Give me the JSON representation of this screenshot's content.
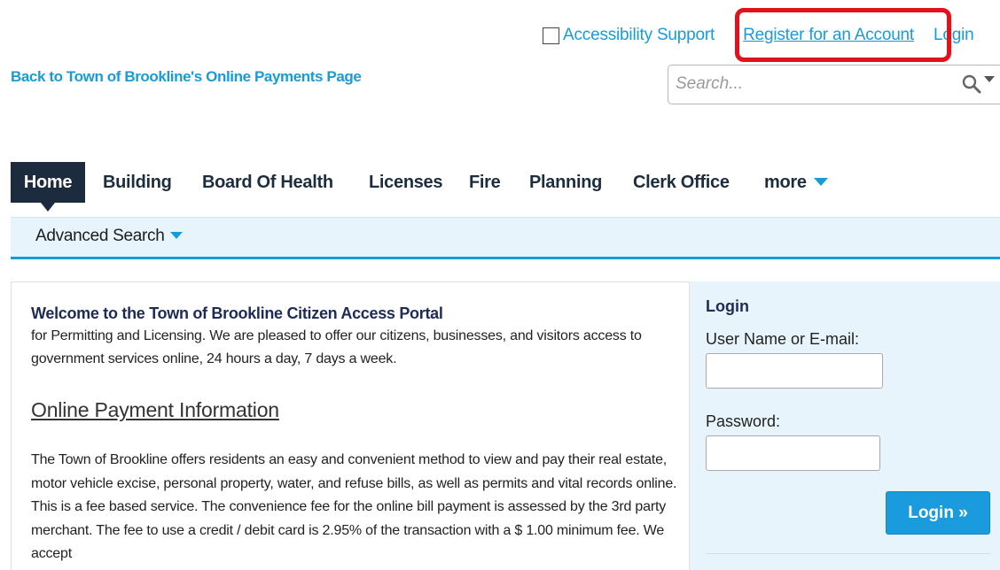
{
  "header": {
    "accessibility_label": "Accessibility Support",
    "register_label": "Register for an Account",
    "login_label": "Login",
    "back_link": "Back to Town of Brookline's Online Payments Page",
    "search_placeholder": "Search..."
  },
  "nav": {
    "tabs": [
      {
        "label": "Home"
      },
      {
        "label": "Building"
      },
      {
        "label": "Board Of Health"
      },
      {
        "label": "Licenses"
      },
      {
        "label": "Fire"
      },
      {
        "label": "Planning"
      },
      {
        "label": "Clerk Office"
      },
      {
        "label": "more"
      }
    ],
    "sub_label": "Advanced Search"
  },
  "main": {
    "welcome_title": "Welcome to the Town of Brookline Citizen Access Portal",
    "welcome_text": "for Permitting and Licensing. We are pleased to offer our citizens, businesses, and visitors access to government services online, 24 hours a day, 7 days a week.",
    "payment_heading": "Online Payment Information",
    "payment_text": "The Town of Brookline offers residents an easy and convenient method to view and pay their real estate, motor vehicle excise, personal property, water, and refuse bills, as well as permits and vital records online. This is a fee based service. The convenience fee for the online bill payment is assessed by the 3rd party merchant. The fee to use a credit / debit card is 2.95% of the transaction with a $ 1.00 minimum fee. We accept"
  },
  "login_panel": {
    "title": "Login",
    "username_label": "User Name or E-mail:",
    "password_label": "Password:",
    "button_label": "Login »"
  },
  "colors": {
    "link": "#1a9bd7",
    "nav_active": "#1d2b3e",
    "highlight": "#e3111b",
    "panel_bg": "#e8f4fb",
    "button": "#1a9bde"
  },
  "icons": {
    "search": "magnifier-icon",
    "dropdown": "caret-down-icon"
  }
}
